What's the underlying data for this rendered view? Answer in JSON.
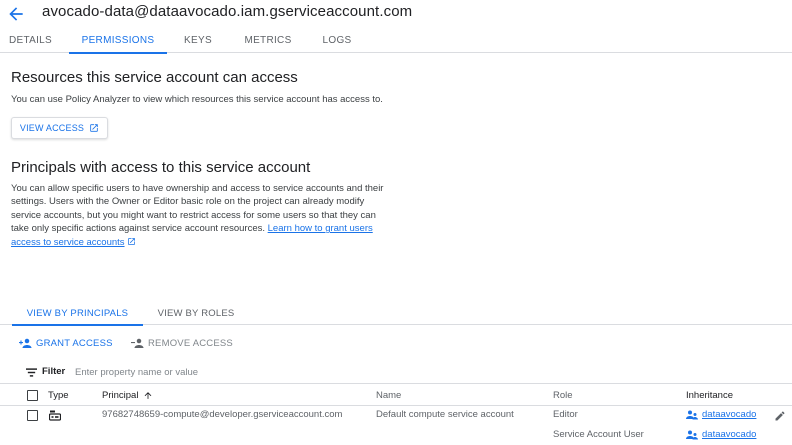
{
  "header": {
    "back_icon": "arrow-back-icon",
    "title": "avocado-data@dataavocado.iam.gserviceaccount.com"
  },
  "tabs": [
    {
      "label": "DETAILS",
      "active": false
    },
    {
      "label": "PERMISSIONS",
      "active": true
    },
    {
      "label": "KEYS",
      "active": false
    },
    {
      "label": "METRICS",
      "active": false
    },
    {
      "label": "LOGS",
      "active": false
    }
  ],
  "resources": {
    "heading": "Resources this service account can access",
    "description": "You can use Policy Analyzer to view which resources this service account has access to.",
    "button_label": "VIEW ACCESS",
    "button_icon": "open-in-new-icon"
  },
  "principals": {
    "heading": "Principals with access to this service account",
    "description_lines": [
      "You can allow specific users to have ownership and access to service accounts and their",
      "settings. Users with the Owner or Editor basic role on the project can already modify",
      "service accounts, but you might want to restrict access for some users so that they can",
      "take only specific actions against service account resources."
    ],
    "link_part1": "Learn how to grant users",
    "link_part2": "access to service accounts"
  },
  "view_tabs": [
    {
      "label": "VIEW BY PRINCIPALS",
      "active": true
    },
    {
      "label": "VIEW BY ROLES",
      "active": false
    }
  ],
  "actions": {
    "grant": "GRANT ACCESS",
    "grant_icon": "person-add-icon",
    "remove": "REMOVE ACCESS",
    "remove_icon": "person-remove-icon"
  },
  "filter": {
    "label": "Filter",
    "icon": "filter-list-icon",
    "placeholder": "Enter property name or value"
  },
  "table": {
    "columns": {
      "type": "Type",
      "principal": "Principal",
      "name": "Name",
      "role": "Role",
      "inheritance": "Inheritance"
    },
    "sort_icon": "arrow-up-icon",
    "rows": [
      {
        "type_icon": "service-account-icon",
        "principal": "97682748659-compute@developer.gserviceaccount.com",
        "name": "Default compute service account",
        "role": "Editor",
        "inheritance": "dataavocado",
        "inheritance_icon": "project-people-icon",
        "edit_icon": "pencil-icon"
      },
      {
        "principal": "",
        "name": "",
        "role": "Service Account User",
        "inheritance": "dataavocado",
        "inheritance_icon": "project-people-icon"
      }
    ]
  },
  "colors": {
    "accent": "#1a73e8",
    "text_primary": "#202124",
    "text_secondary": "#5f6368",
    "divider": "#dadce0"
  }
}
